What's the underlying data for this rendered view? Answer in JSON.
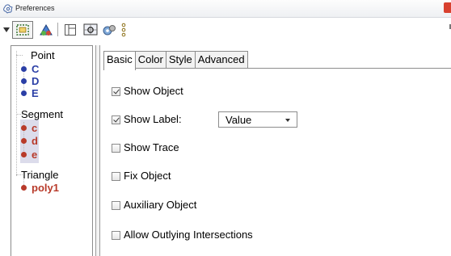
{
  "window": {
    "title": "Preferences"
  },
  "toolbar": {
    "icons": [
      "dropdown-arrow-icon",
      "select-all-icon",
      "geometry-shapes-icon",
      "layout-icon",
      "graphics-settings-icon",
      "defaults-icon",
      "more-icon"
    ]
  },
  "tree": {
    "groups": [
      {
        "label": "Point",
        "items": [
          {
            "name": "C",
            "color": "#2b3fa6"
          },
          {
            "name": "D",
            "color": "#2b3fa6"
          },
          {
            "name": "E",
            "color": "#2b3fa6"
          }
        ]
      },
      {
        "label": "Segment",
        "items": [
          {
            "name": "c",
            "color": "#b83a2a"
          },
          {
            "name": "d",
            "color": "#b83a2a"
          },
          {
            "name": "e",
            "color": "#b83a2a"
          }
        ]
      },
      {
        "label": "Triangle",
        "items": [
          {
            "name": "poly1",
            "color": "#b83a2a"
          }
        ]
      }
    ]
  },
  "tabs": {
    "basic": "Basic",
    "color": "Color",
    "style": "Style",
    "advanced": "Advanced",
    "active": "Basic"
  },
  "options": {
    "show_object": {
      "label": "Show Object",
      "checked": true
    },
    "show_label": {
      "label": "Show Label:",
      "checked": true,
      "value": "Value"
    },
    "show_trace": {
      "label": "Show Trace",
      "checked": false
    },
    "fix_object": {
      "label": "Fix Object",
      "checked": false
    },
    "auxiliary_object": {
      "label": "Auxiliary Object",
      "checked": false
    },
    "allow_outlying": {
      "label": "Allow Outlying Intersections",
      "checked": false
    }
  }
}
